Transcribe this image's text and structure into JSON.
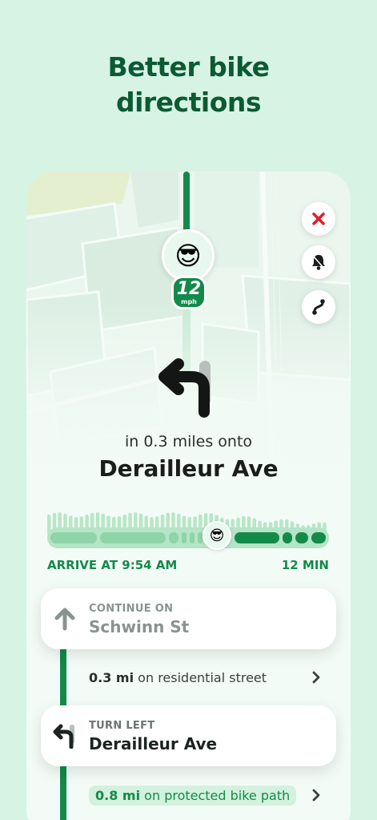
{
  "headline": {
    "line1": "Better bike",
    "line2": "directions"
  },
  "map_overlay": {
    "rider_emoji": "😎",
    "speed_value": "12",
    "speed_unit": "mph",
    "buttons": [
      {
        "name": "close-icon",
        "color": "#e11d2a"
      },
      {
        "name": "bell-icon",
        "color": "#1a1d1b"
      },
      {
        "name": "route-options-icon",
        "color": "#1a1d1b"
      }
    ]
  },
  "instruction": {
    "distance_text": "in 0.3 miles onto",
    "street": "Derailleur Ave",
    "maneuver_icon": "turn-left-arrow-icon"
  },
  "trip": {
    "arrive_label": "ARRIVE AT 9:54 AM",
    "duration_label": "12 MIN",
    "progress_emoji": "😎"
  },
  "steps": [
    {
      "kicker": "CONTINUE ON",
      "street": "Schwinn St",
      "icon": "arrow-up-icon"
    },
    {
      "kicker": "TURN LEFT",
      "street": "Derailleur Ave",
      "icon": "turn-left-icon"
    }
  ],
  "segments": [
    {
      "distance": "0.3 mi",
      "description": "on residential street"
    },
    {
      "distance": "0.8 mi",
      "description": "on protected bike path"
    }
  ],
  "colors": {
    "brand_green": "#138a4a",
    "headline_green": "#0b5a33",
    "background": "#d7f3e4",
    "close_red": "#e11d2a"
  }
}
